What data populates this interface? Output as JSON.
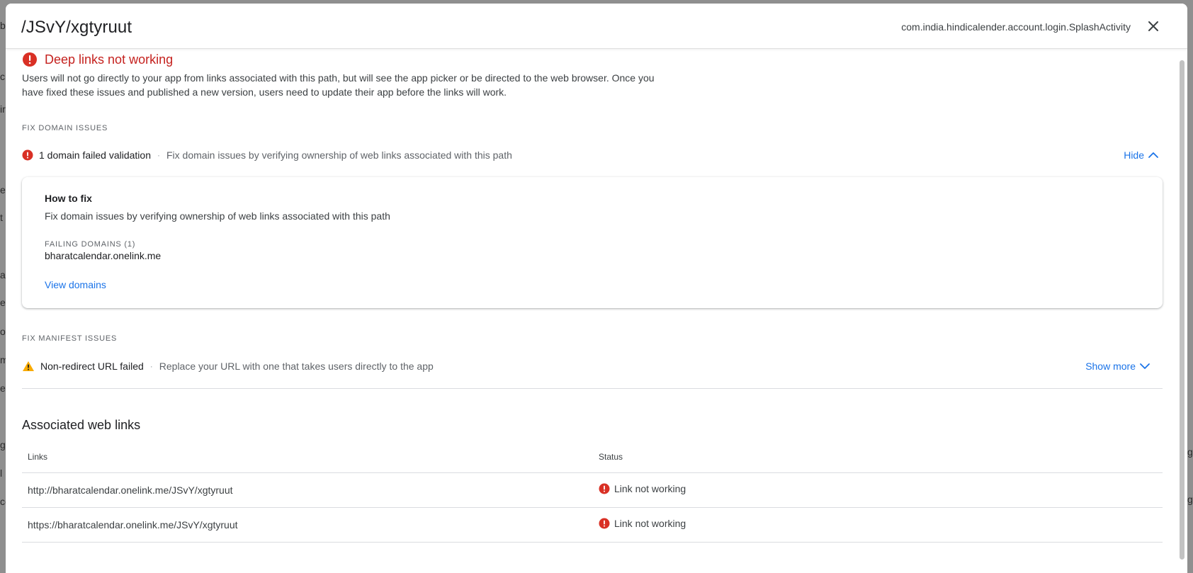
{
  "background": {
    "left_fragments": [
      "ba",
      "c",
      "ir",
      "es",
      "t",
      "ar",
      "ev",
      "o",
      "m",
      "e",
      "g",
      "l",
      "ce"
    ],
    "right_fragments": [
      "g",
      "g"
    ]
  },
  "dialog": {
    "title": "/JSvY/xgtyruut",
    "activity": "com.india.hindicalender.account.login.SplashActivity",
    "close_icon": "close-icon"
  },
  "alert": {
    "icon": "error-icon",
    "title": "Deep links not working",
    "description": "Users will not go directly to your app from links associated with this path, but will see the app picker or be directed to the web browser. Once you have fixed these issues and published a new version, users need to update their app before the links will work."
  },
  "domain_section": {
    "label": "FIX DOMAIN ISSUES",
    "issue_title": "1 domain failed validation",
    "separator": "·",
    "issue_desc": "Fix domain issues by verifying ownership of web links associated with this path",
    "toggle_label": "Hide",
    "card": {
      "title": "How to fix",
      "desc": "Fix domain issues by verifying ownership of web links associated with this path",
      "failing_label": "FAILING DOMAINS (1)",
      "domain": "bharatcalendar.onelink.me",
      "link": "View domains"
    }
  },
  "manifest_section": {
    "label": "FIX MANIFEST ISSUES",
    "issue_title": "Non-redirect URL failed",
    "separator": "·",
    "issue_desc": "Replace your URL with one that takes users directly to the app",
    "toggle_label": "Show more"
  },
  "web_links": {
    "heading": "Associated web links",
    "columns": [
      "Links",
      "Status"
    ],
    "rows": [
      {
        "link": "http://bharatcalendar.onelink.me/JSvY/xgtyruut",
        "status": "Link not working"
      },
      {
        "link": "https://bharatcalendar.onelink.me/JSvY/xgtyruut",
        "status": "Link not working"
      }
    ]
  },
  "colors": {
    "error": "#d93025",
    "warning": "#f9ab00",
    "link": "#1a73e8"
  }
}
